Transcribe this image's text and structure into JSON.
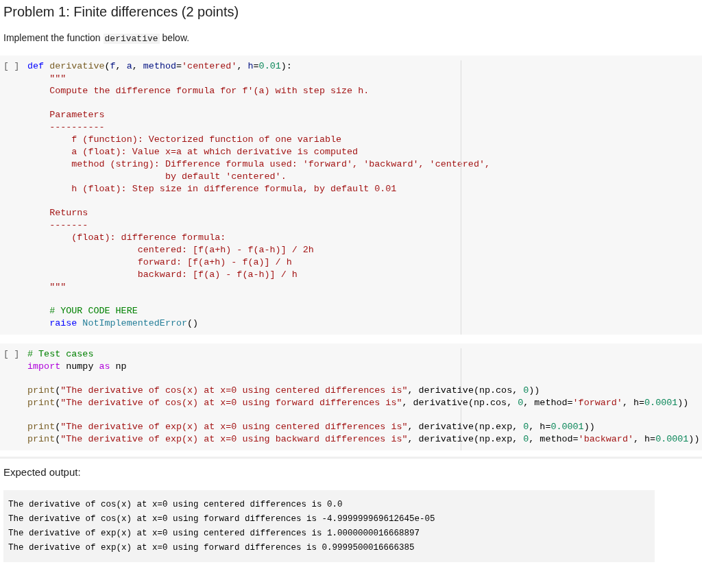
{
  "title": "Problem 1: Finite differences (2 points)",
  "intro": [
    {
      "text": "Implement the function ",
      "code": false
    },
    {
      "text": "derivative",
      "code": true
    },
    {
      "text": " below.",
      "code": false
    }
  ],
  "cells": [
    {
      "prompt": "[ ]",
      "lines": [
        {
          "gap_before": false,
          "tokens": [
            {
              "kind": "kw",
              "t": "def"
            },
            {
              "kind": "fn",
              "t": " derivative"
            },
            {
              "kind": "plain",
              "t": "("
            },
            {
              "kind": "param",
              "t": "f"
            },
            {
              "kind": "plain",
              "t": ", "
            },
            {
              "kind": "param",
              "t": "a"
            },
            {
              "kind": "plain",
              "t": ", "
            },
            {
              "kind": "param",
              "t": "method"
            },
            {
              "kind": "plain",
              "t": "="
            },
            {
              "kind": "str",
              "t": "'centered'"
            },
            {
              "kind": "plain",
              "t": ", "
            },
            {
              "kind": "param",
              "t": "h"
            },
            {
              "kind": "plain",
              "t": "="
            },
            {
              "kind": "num",
              "t": "0.01"
            },
            {
              "kind": "plain",
              "t": "):"
            }
          ]
        },
        {
          "gap_before": false,
          "tokens": [
            {
              "kind": "str",
              "t": "    \"\"\""
            }
          ]
        },
        {
          "gap_before": false,
          "tokens": [
            {
              "kind": "str",
              "t": "    Compute the difference formula for f'(a) with step size h."
            }
          ]
        },
        {
          "gap_before": true,
          "tokens": [
            {
              "kind": "str",
              "t": "    Parameters"
            }
          ]
        },
        {
          "gap_before": false,
          "tokens": [
            {
              "kind": "str",
              "t": "    ----------"
            }
          ]
        },
        {
          "gap_before": false,
          "tokens": [
            {
              "kind": "str",
              "t": "        f (function): Vectorized function of one variable"
            }
          ]
        },
        {
          "gap_before": false,
          "tokens": [
            {
              "kind": "str",
              "t": "        a (float): Value x=a at which derivative is computed"
            }
          ]
        },
        {
          "gap_before": false,
          "tokens": [
            {
              "kind": "str",
              "t": "        method (string): Difference formula used: 'forward', 'backward', 'centered',"
            }
          ]
        },
        {
          "gap_before": false,
          "tokens": [
            {
              "kind": "str",
              "t": "                         by default 'centered'."
            }
          ]
        },
        {
          "gap_before": false,
          "tokens": [
            {
              "kind": "str",
              "t": "        h (float): Step size in difference formula, by default 0.01"
            }
          ]
        },
        {
          "gap_before": true,
          "tokens": [
            {
              "kind": "str",
              "t": "    Returns"
            }
          ]
        },
        {
          "gap_before": false,
          "tokens": [
            {
              "kind": "str",
              "t": "    -------"
            }
          ]
        },
        {
          "gap_before": false,
          "tokens": [
            {
              "kind": "str",
              "t": "        (float): difference formula:"
            }
          ]
        },
        {
          "gap_before": false,
          "tokens": [
            {
              "kind": "str",
              "t": "                    centered: [f(a+h) - f(a-h)] / 2h"
            }
          ]
        },
        {
          "gap_before": false,
          "tokens": [
            {
              "kind": "str",
              "t": "                    forward: [f(a+h) - f(a)] / h"
            }
          ]
        },
        {
          "gap_before": false,
          "tokens": [
            {
              "kind": "str",
              "t": "                    backward: [f(a) - f(a-h)] / h"
            }
          ]
        },
        {
          "gap_before": false,
          "tokens": [
            {
              "kind": "str",
              "t": "    \"\"\""
            }
          ]
        },
        {
          "gap_before": true,
          "tokens": [
            {
              "kind": "comment",
              "t": "    # YOUR CODE HERE"
            }
          ]
        },
        {
          "gap_before": false,
          "tokens": [
            {
              "kind": "kw",
              "t": "    raise"
            },
            {
              "kind": "builtin",
              "t": " NotImplementedError"
            },
            {
              "kind": "plain",
              "t": "()"
            }
          ]
        }
      ]
    },
    {
      "prompt": "[ ]",
      "lines": [
        {
          "gap_before": false,
          "tokens": [
            {
              "kind": "comment",
              "t": "# Test cases"
            }
          ]
        },
        {
          "gap_before": false,
          "tokens": [
            {
              "kind": "import",
              "t": "import"
            },
            {
              "kind": "plain",
              "t": " numpy "
            },
            {
              "kind": "import",
              "t": "as"
            },
            {
              "kind": "plain",
              "t": " np"
            }
          ]
        },
        {
          "gap_before": true,
          "tokens": [
            {
              "kind": "fn",
              "t": "print"
            },
            {
              "kind": "plain",
              "t": "("
            },
            {
              "kind": "str",
              "t": "\"The derivative of cos(x) at x=0 using centered differences is\""
            },
            {
              "kind": "plain",
              "t": ", derivative(np.cos, "
            },
            {
              "kind": "num",
              "t": "0"
            },
            {
              "kind": "plain",
              "t": "))"
            }
          ]
        },
        {
          "gap_before": false,
          "tokens": [
            {
              "kind": "fn",
              "t": "print"
            },
            {
              "kind": "plain",
              "t": "("
            },
            {
              "kind": "str",
              "t": "\"The derivative of cos(x) at x=0 using forward differences is\""
            },
            {
              "kind": "plain",
              "t": ", derivative(np.cos, "
            },
            {
              "kind": "num",
              "t": "0"
            },
            {
              "kind": "plain",
              "t": ", method="
            },
            {
              "kind": "str",
              "t": "'forward'"
            },
            {
              "kind": "plain",
              "t": ", h="
            },
            {
              "kind": "num",
              "t": "0.0001"
            },
            {
              "kind": "plain",
              "t": "))"
            }
          ]
        },
        {
          "gap_before": true,
          "tokens": [
            {
              "kind": "fn",
              "t": "print"
            },
            {
              "kind": "plain",
              "t": "("
            },
            {
              "kind": "str",
              "t": "\"The derivative of exp(x) at x=0 using centered differences is\""
            },
            {
              "kind": "plain",
              "t": ", derivative(np.exp, "
            },
            {
              "kind": "num",
              "t": "0"
            },
            {
              "kind": "plain",
              "t": ", h="
            },
            {
              "kind": "num",
              "t": "0.0001"
            },
            {
              "kind": "plain",
              "t": "))"
            }
          ]
        },
        {
          "gap_before": false,
          "tokens": [
            {
              "kind": "fn",
              "t": "print"
            },
            {
              "kind": "plain",
              "t": "("
            },
            {
              "kind": "str",
              "t": "\"The derivative of exp(x) at x=0 using backward differences is\""
            },
            {
              "kind": "plain",
              "t": ", derivative(np.exp, "
            },
            {
              "kind": "num",
              "t": "0"
            },
            {
              "kind": "plain",
              "t": ", method="
            },
            {
              "kind": "str",
              "t": "'backward'"
            },
            {
              "kind": "plain",
              "t": ", h="
            },
            {
              "kind": "num",
              "t": "0.0001"
            },
            {
              "kind": "plain",
              "t": "))"
            }
          ]
        }
      ]
    }
  ],
  "expected_label": "Expected output:",
  "expected_lines": [
    "The derivative of cos(x) at x=0 using centered differences is 0.0",
    "The derivative of cos(x) at x=0 using forward differences is -4.999999969612645e-05",
    "The derivative of exp(x) at x=0 using centered differences is 1.0000000016668897",
    "The derivative of exp(x) at x=0 using forward differences is 0.9999500016666385"
  ]
}
